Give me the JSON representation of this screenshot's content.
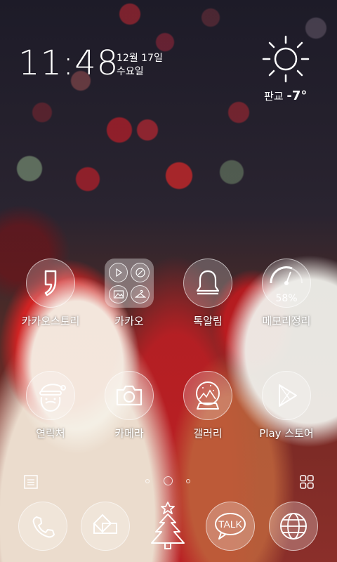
{
  "clock": {
    "time": "11:48",
    "date": "12월 17일",
    "day": "수요일"
  },
  "weather": {
    "icon": "sun-icon",
    "location": "판교",
    "temperature": "-7°"
  },
  "apps_row1": [
    {
      "label": "카카오스토리",
      "icon": "kakaostory-icon"
    },
    {
      "label": "카카오",
      "icon": "kakao-folder-icon"
    },
    {
      "label": "톡알림",
      "icon": "bell-icon"
    },
    {
      "label": "메모리정리",
      "icon": "memory-gauge-icon",
      "value": "58%"
    }
  ],
  "apps_row2": [
    {
      "label": "연락처",
      "icon": "santa-icon"
    },
    {
      "label": "카메라",
      "icon": "camera-icon"
    },
    {
      "label": "갤러리",
      "icon": "snowglobe-icon"
    },
    {
      "label": "Play 스토어",
      "icon": "play-store-icon"
    }
  ],
  "pager": {
    "pages": 3,
    "current": 2
  },
  "dock": [
    {
      "name": "phone-icon"
    },
    {
      "name": "messages-icon"
    },
    {
      "name": "christmas-tree-icon"
    },
    {
      "name": "talk-icon",
      "text": "TALK"
    },
    {
      "name": "globe-icon"
    }
  ]
}
